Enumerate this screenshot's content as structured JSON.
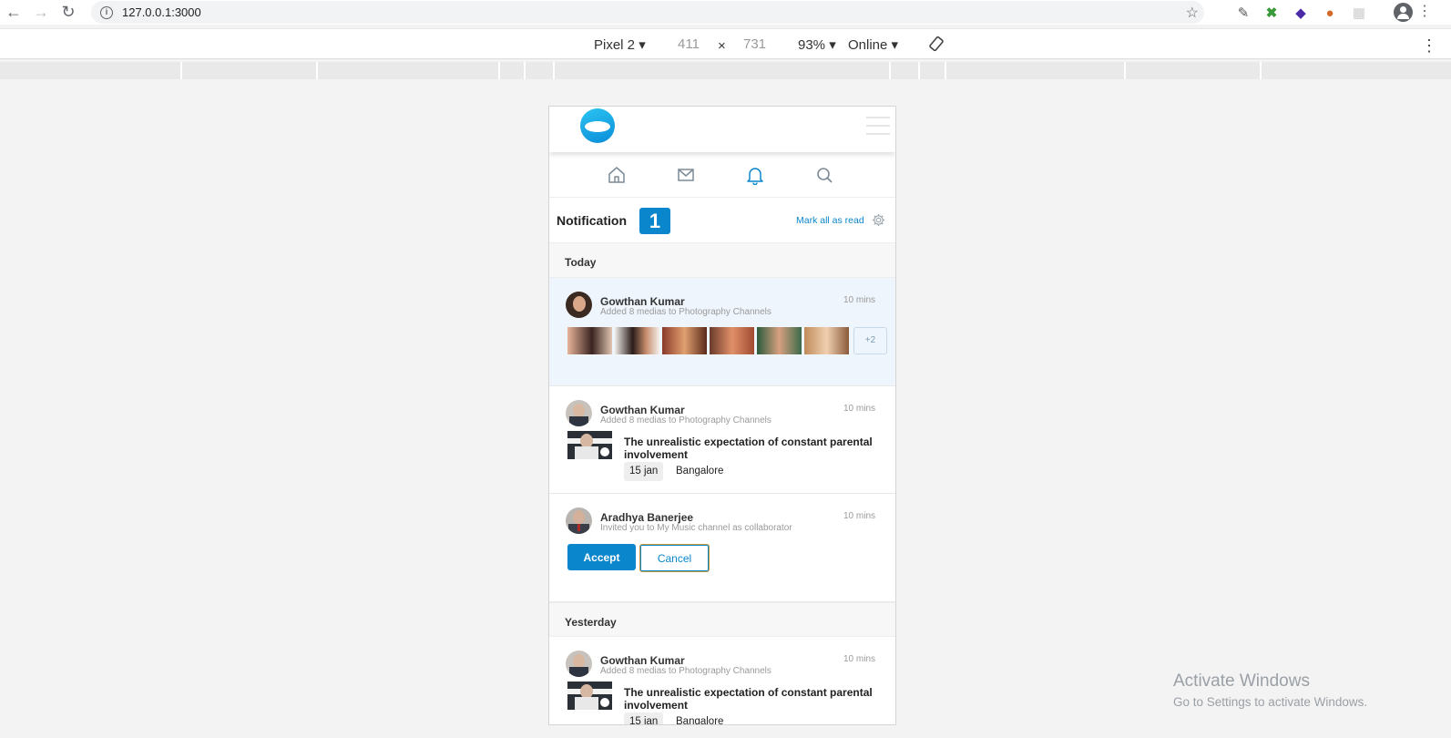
{
  "browser": {
    "url": "127.0.0.1:3000"
  },
  "device_toolbar": {
    "device": "Pixel 2",
    "width": "411",
    "times": "×",
    "height": "731",
    "zoom": "93%",
    "network": "Online"
  },
  "app": {
    "tabs": [
      "home",
      "messages",
      "notifications",
      "search"
    ],
    "active_tab": "notifications",
    "notification_title": "Notification",
    "notification_count": "1",
    "mark_all_read": "Mark all as read",
    "sections": {
      "today": "Today",
      "yesterday": "Yesterday"
    },
    "items": [
      {
        "name": "Gowthan Kumar",
        "desc": "Added 8 medias to Photography Channels",
        "time": "10 mins",
        "more": "+2"
      },
      {
        "name": "Gowthan Kumar",
        "desc": "Added 8 medias to Photography Channels",
        "time": "10 mins",
        "post_title": "The unrealistic expectation of constant parental involvement",
        "date": "15 jan",
        "location": "Bangalore"
      },
      {
        "name": "Aradhya Banerjee",
        "desc": "Invited you to My Music channel as collaborator",
        "time": "10 mins",
        "accept": "Accept",
        "cancel": "Cancel"
      },
      {
        "name": "Gowthan Kumar",
        "desc": "Added 8 medias to Photography Channels",
        "time": "10 mins",
        "post_title": "The unrealistic expectation of constant parental involvement",
        "date": "15 jan",
        "location": "Bangalore"
      }
    ]
  },
  "watermark": {
    "line1": "Activate Windows",
    "line2": "Go to Settings to activate Windows."
  },
  "colors": {
    "accent": "#0a86cc",
    "unread_bg": "#eef5fc"
  }
}
